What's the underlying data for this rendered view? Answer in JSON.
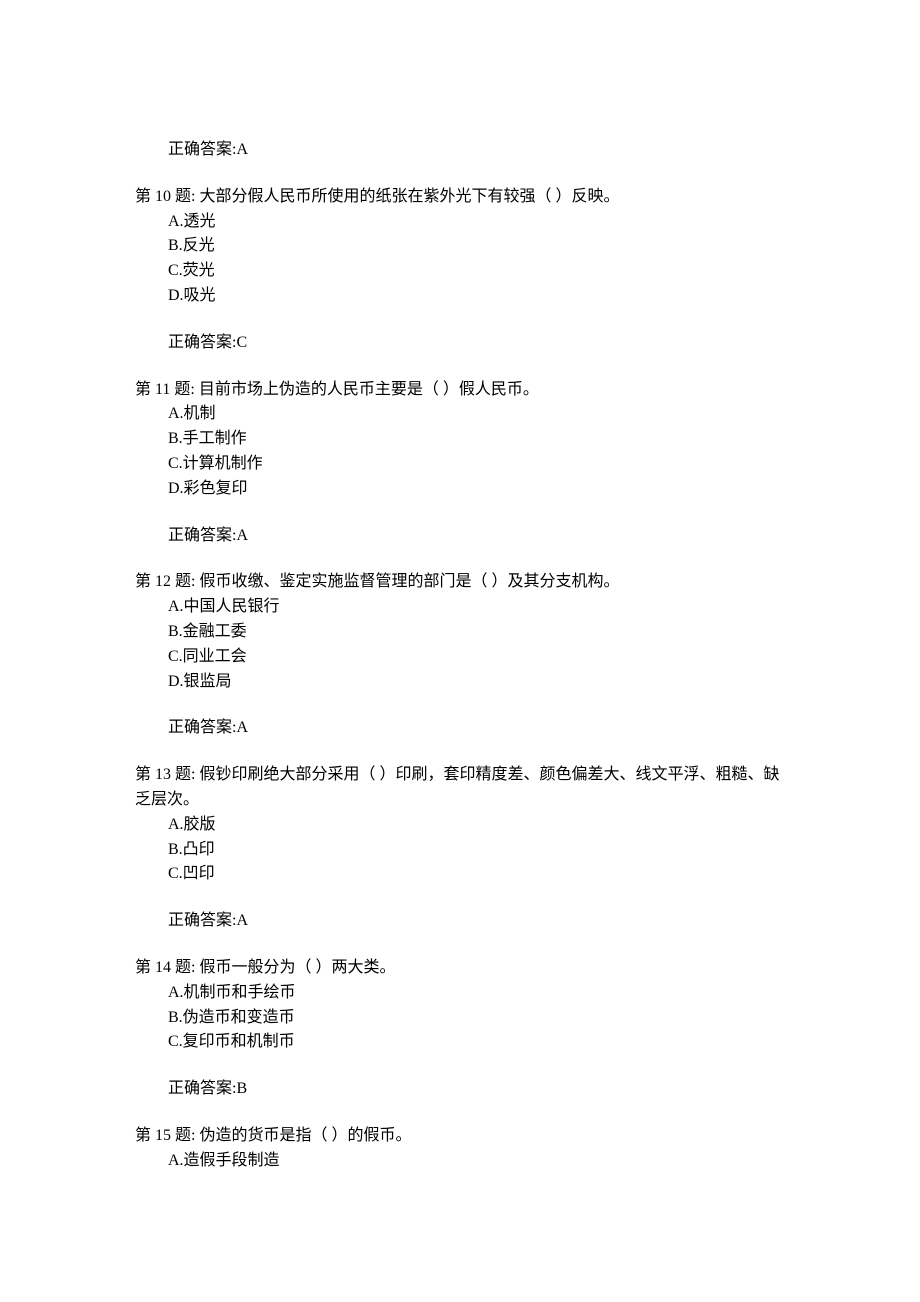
{
  "answerLabel": "正确答案:",
  "questionPrefix": "第 ",
  "questionSuffix": " 题:  ",
  "prevAnswer": "A",
  "questions": [
    {
      "num": "10",
      "text": "大部分假人民币所使用的纸张在紫外光下有较强（  ）反映。",
      "options": [
        "A.透光",
        "B.反光",
        "C.荧光",
        "D.吸光"
      ],
      "answer": "C"
    },
    {
      "num": "11",
      "text": "目前市场上伪造的人民币主要是（        ）假人民币。",
      "options": [
        "A.机制",
        "B.手工制作",
        "C.计算机制作",
        "D.彩色复印"
      ],
      "answer": "A"
    },
    {
      "num": "12",
      "text": "假币收缴、鉴定实施监督管理的部门是（  ）及其分支机构。",
      "options": [
        "A.中国人民银行",
        "B.金融工委",
        "C.同业工会",
        "D.银监局"
      ],
      "answer": "A"
    },
    {
      "num": "13",
      "text": "假钞印刷绝大部分采用（  ）印刷，套印精度差、颜色偏差大、线文平浮、粗糙、缺乏层次。",
      "options": [
        "A.胶版",
        "B.凸印",
        "C.凹印"
      ],
      "answer": "A"
    },
    {
      "num": "14",
      "text": "假币一般分为（  ）两大类。",
      "options": [
        "A.机制币和手绘币",
        "B.伪造币和变造币",
        "C.复印币和机制币"
      ],
      "answer": "B"
    },
    {
      "num": "15",
      "text": "伪造的货币是指（  ）的假币。",
      "options": [
        "A.造假手段制造"
      ],
      "answer": null
    }
  ]
}
